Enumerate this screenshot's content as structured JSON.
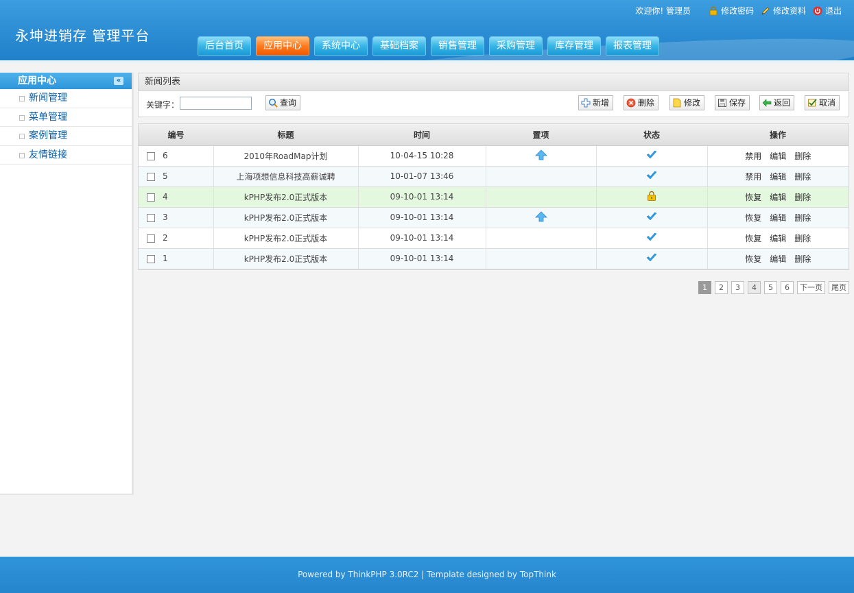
{
  "header": {
    "brand": "永坤进销存 管理平台",
    "welcome": "欢迎你! 管理员",
    "links": [
      {
        "label": "修改密码",
        "icon": "lock-icon"
      },
      {
        "label": "修改资料",
        "icon": "pencil-icon"
      },
      {
        "label": "退出",
        "icon": "power-icon"
      }
    ],
    "nav": [
      {
        "label": "后台首页",
        "active": false
      },
      {
        "label": "应用中心",
        "active": true
      },
      {
        "label": "系统中心",
        "active": false
      },
      {
        "label": "基础档案",
        "active": false
      },
      {
        "label": "销售管理",
        "active": false
      },
      {
        "label": "采购管理",
        "active": false
      },
      {
        "label": "库存管理",
        "active": false
      },
      {
        "label": "报表管理",
        "active": false
      }
    ]
  },
  "sidebar": {
    "title": "应用中心",
    "collapse_glyph": "«",
    "items": [
      "新闻管理",
      "菜单管理",
      "案例管理",
      "友情链接"
    ]
  },
  "panel": {
    "title": "新闻列表",
    "keyword_label": "关键字：",
    "keyword_value": "",
    "search_label": "查询",
    "actions": [
      {
        "label": "新增",
        "icon": "plus-icon"
      },
      {
        "label": "删除",
        "icon": "delete-icon"
      },
      {
        "label": "修改",
        "icon": "edit-icon"
      },
      {
        "label": "保存",
        "icon": "save-icon"
      },
      {
        "label": "返回",
        "icon": "back-arrow-icon"
      },
      {
        "label": "取消",
        "icon": "cancel-icon"
      }
    ]
  },
  "table": {
    "columns": [
      "编号",
      "标题",
      "时间",
      "置项",
      "状态",
      "操作"
    ],
    "rows": [
      {
        "id": "6",
        "title": "2010年RoadMap计划",
        "time": "10-04-15 10:28",
        "top": true,
        "status": "check",
        "toggle": "禁用",
        "edit": "编辑",
        "del": "删除"
      },
      {
        "id": "5",
        "title": "上海项想信息科技高薪诚聘",
        "time": "10-01-07 13:46",
        "top": false,
        "status": "check",
        "toggle": "禁用",
        "edit": "编辑",
        "del": "删除"
      },
      {
        "id": "4",
        "title": "kPHP发布2.0正式版本",
        "time": "09-10-01 13:14",
        "top": false,
        "status": "lock",
        "toggle": "恢复",
        "edit": "编辑",
        "del": "删除"
      },
      {
        "id": "3",
        "title": "kPHP发布2.0正式版本",
        "time": "09-10-01 13:14",
        "top": true,
        "status": "check",
        "toggle": "恢复",
        "edit": "编辑",
        "del": "删除"
      },
      {
        "id": "2",
        "title": "kPHP发布2.0正式版本",
        "time": "09-10-01 13:14",
        "top": false,
        "status": "check",
        "toggle": "恢复",
        "edit": "编辑",
        "del": "删除"
      },
      {
        "id": "1",
        "title": "kPHP发布2.0正式版本",
        "time": "09-10-01 13:14",
        "top": false,
        "status": "check",
        "toggle": "恢复",
        "edit": "编辑",
        "del": "删除"
      }
    ]
  },
  "pager": {
    "pages": [
      "1",
      "2",
      "3",
      "4",
      "5",
      "6"
    ],
    "current": "1",
    "next": "下一页",
    "last": "尾页"
  },
  "footer": "Powered by ThinkPHP 3.0RC2 | Template designed by TopThink",
  "colors": {
    "primary": "#2b8cd3",
    "active_tab": "#ff7b1f",
    "link": "#0b5fa5",
    "highlight_row": "#e3f8de"
  }
}
